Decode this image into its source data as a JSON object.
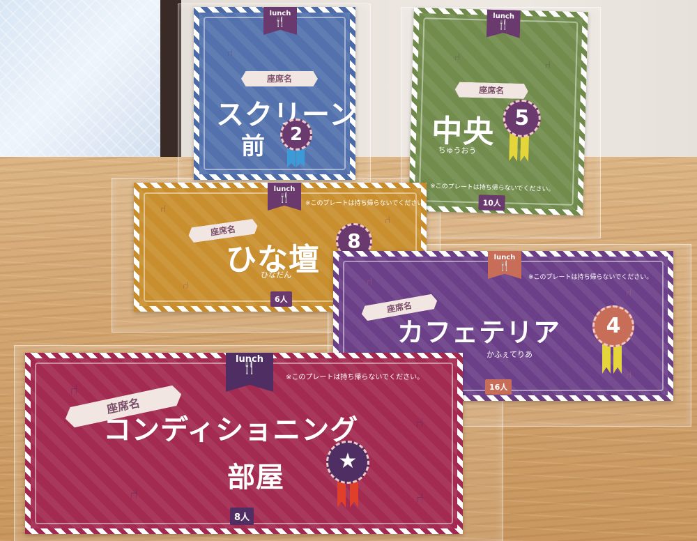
{
  "cards": {
    "screen": {
      "label": "座席名",
      "name_line1": "スクリーン",
      "name_line2": "前",
      "number": "2",
      "tab": "lunch"
    },
    "center": {
      "label": "座席名",
      "name": "中央",
      "number": "5",
      "reading": "ちゅうおう",
      "note": "※このプレートは持ち帰らないでください。",
      "seats": "10人",
      "tab": "lunch"
    },
    "hinadan": {
      "label": "座席名",
      "name": "ひな壇",
      "number": "8",
      "reading": "ひなだん",
      "note": "※このプレートは持ち帰らないでください。",
      "seats": "6人",
      "tab": "lunch"
    },
    "cafeteria": {
      "label": "座席名",
      "name": "カフェテリア",
      "number": "4",
      "reading": "かふぇてりあ",
      "note": "※このプレートは持ち帰らないでください。",
      "seats": "16人",
      "tab": "lunch"
    },
    "conditioning": {
      "label": "座席名",
      "name_line1": "コンディショニング",
      "name_line2": "部屋",
      "star": "★",
      "note": "※このプレートは持ち帰らないでください。",
      "seats": "8人",
      "tab": "lunch"
    }
  },
  "icons": [
    "fork-spoon-icon",
    "chair-icon",
    "rosette-icon",
    "star-icon",
    "ribbon-icon"
  ],
  "colors": {
    "blue": "#4c6aa5",
    "green": "#6f8a4a",
    "orange": "#c88c2a",
    "purple": "#6a3f86",
    "red": "#a3284f"
  }
}
